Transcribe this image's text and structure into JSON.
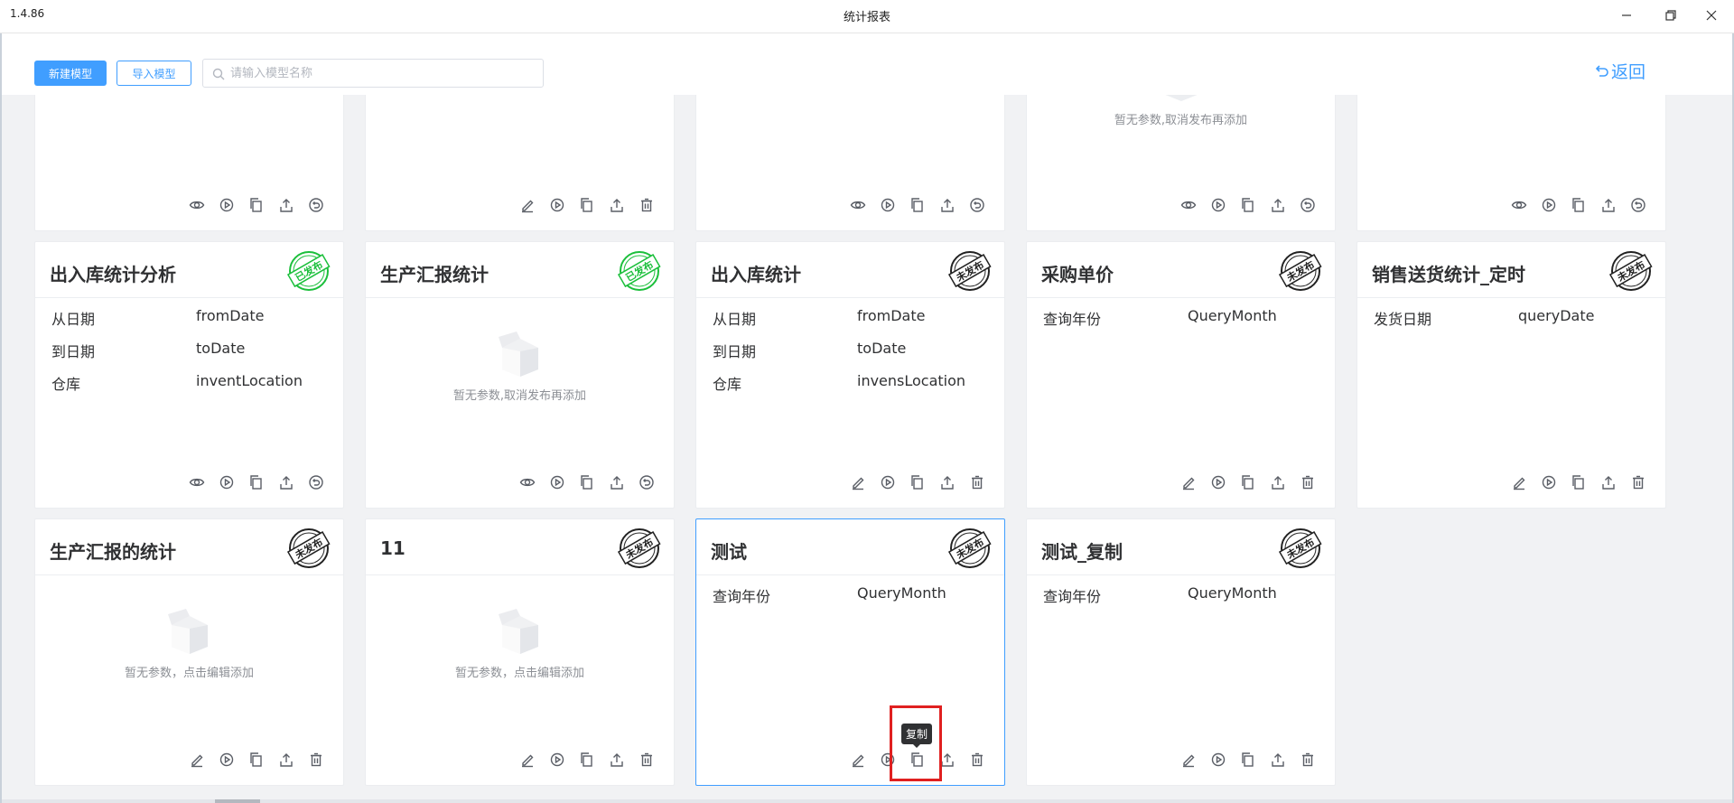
{
  "window": {
    "version": "1.4.86",
    "title": "统计报表",
    "minimize_label": "",
    "maximize_label": "",
    "close_label": ""
  },
  "toolbar": {
    "new_model": "新建模型",
    "import_model": "导入模型",
    "search_placeholder": "请输入模型名称",
    "search_value": "",
    "back": "返回"
  },
  "colors": {
    "primary": "#409eff",
    "published_stamp": "#1bbf3b",
    "unpublished_stamp": "#222222",
    "highlight": "#e02020"
  },
  "stamps": {
    "published": "已发布",
    "unpublished": "未发布"
  },
  "top_row": [
    {
      "empty_text": "",
      "actions": [
        "view",
        "run",
        "copy",
        "export",
        "revoke"
      ]
    },
    {
      "empty_text": "",
      "actions": [
        "edit",
        "run",
        "copy",
        "export",
        "delete"
      ]
    },
    {
      "empty_text": "",
      "actions": [
        "view",
        "run",
        "copy",
        "export",
        "revoke"
      ]
    },
    {
      "empty_text": "暂无参数,取消发布再添加",
      "actions": [
        "view",
        "run",
        "copy",
        "export",
        "revoke"
      ]
    },
    {
      "empty_text": "",
      "actions": [
        "view",
        "run",
        "copy",
        "export",
        "revoke"
      ]
    }
  ],
  "cards": [
    {
      "title": "出入库统计分析",
      "status": "published",
      "params": [
        [
          "从日期",
          "fromDate"
        ],
        [
          "到日期",
          "toDate"
        ],
        [
          "仓库",
          "inventLocation"
        ]
      ],
      "empty_text": "",
      "actions": [
        "view",
        "run",
        "copy",
        "export",
        "revoke"
      ]
    },
    {
      "title": "生产汇报统计",
      "status": "published",
      "params": [],
      "empty_text": "暂无参数,取消发布再添加",
      "actions": [
        "view",
        "run",
        "copy",
        "export",
        "revoke"
      ]
    },
    {
      "title": "出入库统计",
      "status": "unpublished",
      "params": [
        [
          "从日期",
          "fromDate"
        ],
        [
          "到日期",
          "toDate"
        ],
        [
          "仓库",
          "invensLocation"
        ]
      ],
      "empty_text": "",
      "actions": [
        "edit",
        "run",
        "copy",
        "export",
        "delete"
      ]
    },
    {
      "title": "采购单价",
      "status": "unpublished",
      "params": [
        [
          "查询年份",
          "QueryMonth"
        ]
      ],
      "empty_text": "",
      "actions": [
        "edit",
        "run",
        "copy",
        "export",
        "delete"
      ]
    },
    {
      "title": "销售送货统计_定时",
      "status": "unpublished",
      "params": [
        [
          "发货日期",
          "queryDate"
        ]
      ],
      "empty_text": "",
      "actions": [
        "edit",
        "run",
        "copy",
        "export",
        "delete"
      ]
    },
    {
      "title": "生产汇报的统计",
      "status": "unpublished",
      "params": [],
      "empty_text": "暂无参数，点击编辑添加",
      "actions": [
        "edit",
        "run",
        "copy",
        "export",
        "delete"
      ]
    },
    {
      "title": "11",
      "status": "unpublished",
      "params": [],
      "empty_text": "暂无参数，点击编辑添加",
      "actions": [
        "edit",
        "run",
        "copy",
        "export",
        "delete"
      ]
    },
    {
      "title": "测试",
      "status": "unpublished",
      "params": [
        [
          "查询年份",
          "QueryMonth"
        ]
      ],
      "empty_text": "",
      "actions": [
        "edit",
        "run",
        "copy",
        "export",
        "delete"
      ],
      "selected": true
    },
    {
      "title": "测试_复制",
      "status": "unpublished",
      "params": [
        [
          "查询年份",
          "QueryMonth"
        ]
      ],
      "empty_text": "",
      "actions": [
        "edit",
        "run",
        "copy",
        "export",
        "delete"
      ]
    }
  ],
  "tooltip": {
    "text": "复制"
  },
  "icons": {
    "view": "eye-icon",
    "run": "play-icon",
    "copy": "copy-icon",
    "export": "upload-icon",
    "revoke": "revoke-icon",
    "edit": "edit-icon",
    "delete": "trash-icon"
  }
}
